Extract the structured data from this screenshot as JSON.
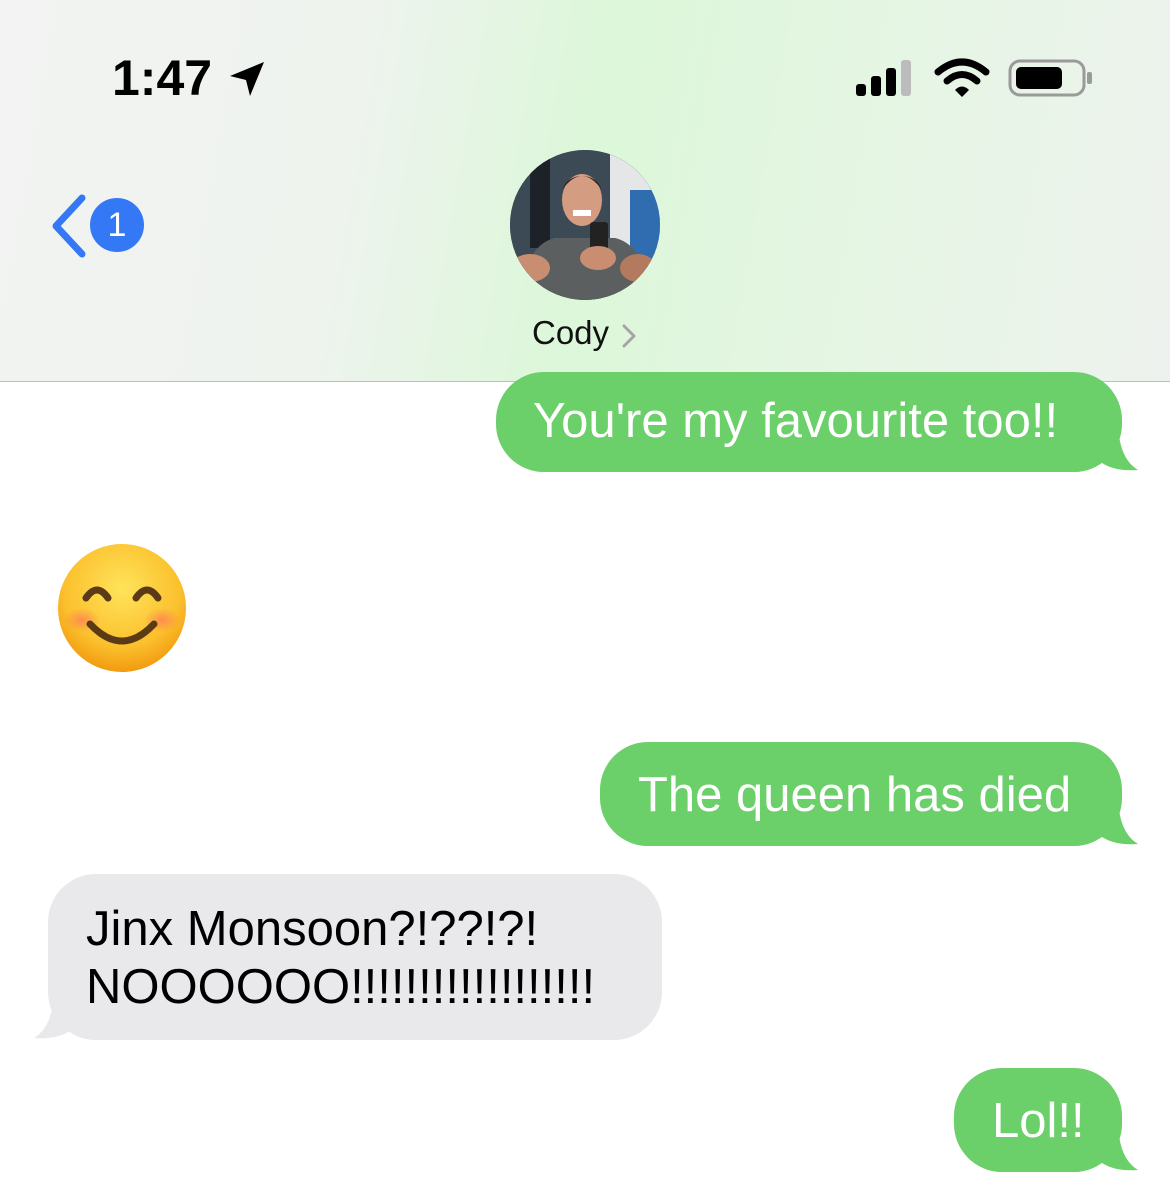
{
  "status_bar": {
    "time": "1:47",
    "icons": [
      "location-arrow-icon",
      "cellular-signal-icon",
      "wifi-icon",
      "battery-icon"
    ]
  },
  "nav": {
    "back_badge": "1",
    "contact_name": "Cody"
  },
  "messages": [
    {
      "direction": "outgoing",
      "text": "You're my favourite too!!"
    },
    {
      "direction": "incoming",
      "emoji": "smiling-face-with-smiling-eyes"
    },
    {
      "direction": "outgoing",
      "text": "The queen has died"
    },
    {
      "direction": "incoming",
      "lines": [
        "Jinx Monsoon?!??!?!",
        "NOOOOOO!!!!!!!!!!!!!!!!!!"
      ]
    },
    {
      "direction": "outgoing",
      "text": "Lol!!"
    }
  ],
  "colors": {
    "outgoing_bubble": "#6bcf6a",
    "incoming_bubble": "#e9e9eb",
    "accent": "#3478f6"
  }
}
